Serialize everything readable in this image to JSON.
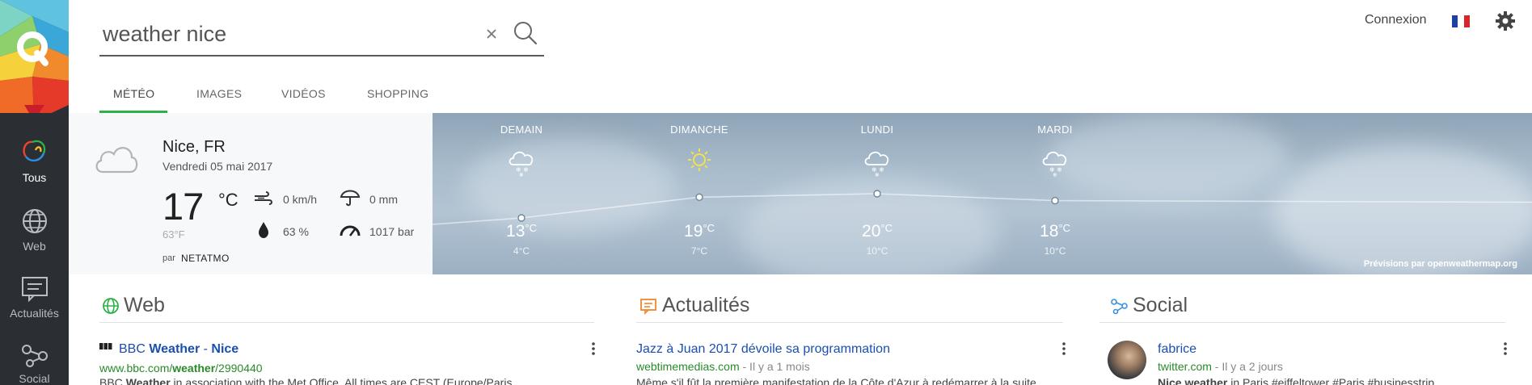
{
  "search": {
    "value": "weather nice",
    "placeholder": ""
  },
  "header": {
    "login": "Connexion"
  },
  "sidebar": {
    "items": [
      {
        "label": "Tous"
      },
      {
        "label": "Web"
      },
      {
        "label": "Actualités"
      },
      {
        "label": "Social"
      }
    ]
  },
  "tabs": [
    {
      "label": "MÉTÉO"
    },
    {
      "label": "IMAGES"
    },
    {
      "label": "VIDÉOS"
    },
    {
      "label": "SHOPPING"
    }
  ],
  "weather": {
    "city": "Nice, FR",
    "date": "Vendredi 05 mai 2017",
    "temp": "17",
    "temp_unit": "°C",
    "temp_f": "63°F",
    "wind": "0 km/h",
    "rain": "0 mm",
    "humidity": "63 %",
    "pressure": "1017 bar",
    "by_prefix": "par",
    "by": "NETATMO",
    "credit": "Prévisions par openweathermap.org",
    "forecast": [
      {
        "day": "DEMAIN",
        "icon": "snow-cloud-icon",
        "high": "13°C",
        "high_value": 13,
        "low": "4°C"
      },
      {
        "day": "DIMANCHE",
        "icon": "sun-icon",
        "high": "19°C",
        "high_value": 19,
        "low": "7°C"
      },
      {
        "day": "LUNDI",
        "icon": "snow-cloud-icon",
        "high": "20°C",
        "high_value": 20,
        "low": "10°C"
      },
      {
        "day": "MARDI",
        "icon": "snow-cloud-icon",
        "high": "18°C",
        "high_value": 18,
        "low": "10°C"
      }
    ]
  },
  "sections": {
    "web": {
      "title": "Web",
      "result": {
        "title_pre": "BBC ",
        "title_b1": "Weather",
        "title_mid": " - ",
        "title_b2": "Nice",
        "url_pre": "www.bbc.com/",
        "url_b": "weather",
        "url_post": "/2990440",
        "snippet_pre": "BBC ",
        "snippet_b": "Weather",
        "snippet_post": " in association with the Met Office. All times are CEST (Europe/Paris"
      }
    },
    "news": {
      "title": "Actualités",
      "result": {
        "title": "Jazz à Juan 2017 dévoile sa programmation",
        "url": "webtimemedias.com",
        "meta": " - Il y a 1 mois",
        "snippet": "Même s'il fût la première manifestation de la Côte d'Azur à redémarrer à la suite"
      }
    },
    "social": {
      "title": "Social",
      "result": {
        "title": "fabrice",
        "url": "twitter.com",
        "meta": " - Il y a 2 jours",
        "snippet_b": "Nice weather",
        "snippet_post": " in Paris #eiffeltower #Paris #businesstrip"
      }
    }
  },
  "colors": {
    "accent": "#2db24a",
    "link": "#1a4fb0",
    "url": "#2a8a2a",
    "sidebar": "#2b2e33"
  }
}
